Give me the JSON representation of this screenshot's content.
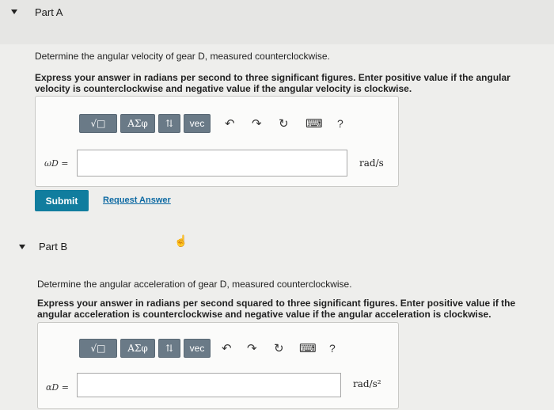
{
  "part_a": {
    "label": "Part A",
    "question": "Determine the angular velocity of gear D, measured counterclockwise.",
    "instruction": "Express your answer in radians per second to three significant figures. Enter positive value if the angular velocity is counterclockwise and negative value if the angular velocity is clockwise.",
    "instruction_line1": "Express your answer in radians per second to three significant figures. Enter positive value if the angular",
    "instruction_line2": "velocity is counterclockwise and negative value if the angular velocity is clockwise.",
    "variable": "ωD =",
    "unit": "rad/s",
    "answer_value": "",
    "submit_label": "Submit",
    "request_label": "Request Answer"
  },
  "part_b": {
    "label": "Part B",
    "question": "Determine the angular acceleration of gear D, measured counterclockwise.",
    "instruction_line1": "Express your answer in radians per second squared to three significant figures. Enter positive value if the",
    "instruction_line2": "angular acceleration is counterclockwise and negative value if the angular acceleration is clockwise.",
    "variable": "αD =",
    "unit": "rad/s²",
    "answer_value": ""
  },
  "toolbar": {
    "template_label": "√□",
    "greek_label": "ΑΣφ",
    "arrows_label": "⇅",
    "vec_label": "vec",
    "undo_label": "↶",
    "redo_label": "↷",
    "reset_label": "↻",
    "keyboard_label": "⌨",
    "help_label": "?"
  },
  "icons": {
    "expand": "caret-down-icon",
    "cursor": "hand-cursor-icon"
  }
}
